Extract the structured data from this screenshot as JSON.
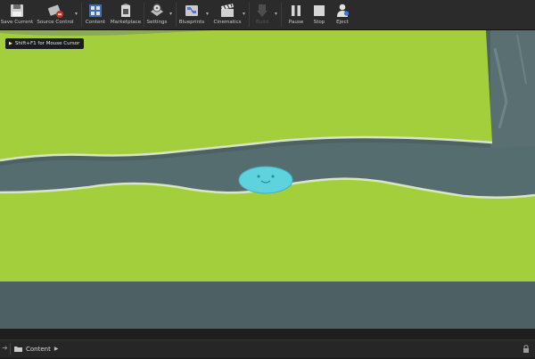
{
  "toolbar": {
    "buttons": [
      {
        "label": "Save Current",
        "icon": "save-icon"
      },
      {
        "label": "Source Control",
        "icon": "source-control-icon"
      },
      {
        "label": "Content",
        "icon": "content-browser-icon"
      },
      {
        "label": "Marketplace",
        "icon": "marketplace-icon"
      },
      {
        "label": "Settings",
        "icon": "settings-icon"
      },
      {
        "label": "Blueprints",
        "icon": "blueprints-icon"
      },
      {
        "label": "Cinematics",
        "icon": "cinematics-icon"
      },
      {
        "label": "Build",
        "icon": "build-icon"
      },
      {
        "label": "Pause",
        "icon": "pause-icon"
      },
      {
        "label": "Stop",
        "icon": "stop-icon"
      },
      {
        "label": "Eject",
        "icon": "eject-icon"
      }
    ]
  },
  "viewport": {
    "hint": "Shift+F1 for Mouse Cursor",
    "colors": {
      "grass": "#a4cf3c",
      "path": "#566d70",
      "border": "#d8e6c6",
      "character": "#5fd3dd",
      "background": "#4e6265"
    }
  },
  "content_browser": {
    "tab_label": "Content"
  }
}
